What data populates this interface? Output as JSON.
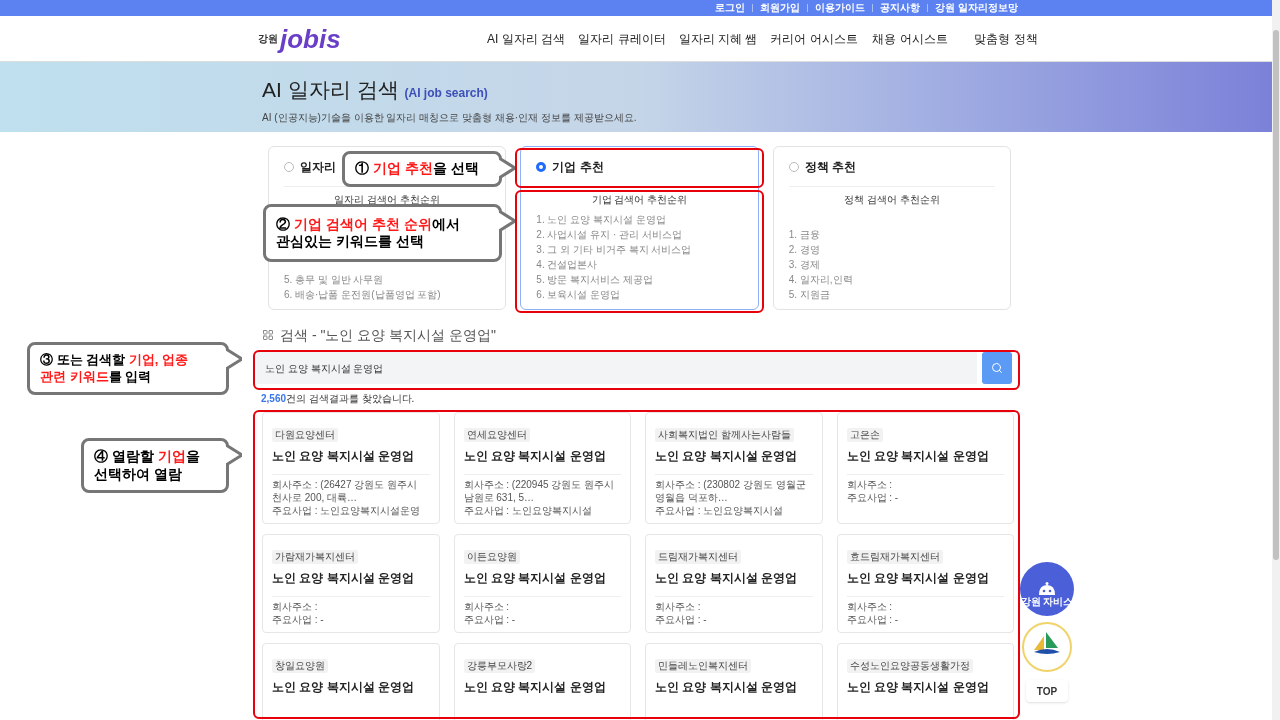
{
  "top_links": [
    "로그인",
    "회원가입",
    "이용가이드",
    "공지사항",
    "강원 일자리정보망"
  ],
  "logo": {
    "region": "강원",
    "name": "jobis"
  },
  "nav": [
    "AI 일자리 검색",
    "일자리 큐레이터",
    "일자리 지혜 쌤",
    "커리어 어시스트",
    "채용 어시스트",
    "맞춤형 정책"
  ],
  "hero": {
    "title": "AI 일자리 검색",
    "title_en": "(AI job search)",
    "description": "AI (인공지능)기술을 이용한 일자리 매칭으로 맞춤형 채용·인재 정보를 제공받으세요."
  },
  "categories": [
    {
      "title": "일자리",
      "selected": false,
      "list_title": "일자리 검색어 추천순위",
      "items": [
        "5. 총무 및 일반 사무원",
        "6. 배송·납품 운전원(납품영업 포함)"
      ]
    },
    {
      "title": "기업 추천",
      "selected": true,
      "list_title": "기업 검색어 추천순위",
      "items": [
        "1. 노인 요양 복지시설 운영업",
        "2. 사업시설 유지 · 관리 서비스업",
        "3. 그 외 기타 비거주 복지 서비스업",
        "4. 건설업본사",
        "5. 방문 복지서비스 제공업",
        "6. 보육시설 운영업"
      ]
    },
    {
      "title": "정책 추천",
      "selected": false,
      "list_title": "정책 검색어 추천순위",
      "items": [
        "1. 금융",
        "2. 경영",
        "3. 경제",
        "4. 일자리,인력",
        "5. 지원금"
      ]
    }
  ],
  "search": {
    "heading": "검색 - \"노인 요양 복지시설 운영업\"",
    "value": "노인 요양 복지시설 운영업"
  },
  "result_count": {
    "number": "2,560",
    "suffix": "건의 검색결과를 찾았습니다."
  },
  "results": [
    {
      "tag": "다원요양센터",
      "title": "노인 요양 복지시설 운영업",
      "address": "회사주소 : (26427 강원도 원주시 천사로 200, 대륙…",
      "business": "주요사업 : 노인요양복지시설운영"
    },
    {
      "tag": "연세요양센터",
      "title": "노인 요양 복지시설 운영업",
      "address": "회사주소 : (220945 강원도 원주시 남원로 631, 5…",
      "business": "주요사업 : 노인요양복지시설"
    },
    {
      "tag": "사회복지법인 함께사는사람들",
      "title": "노인 요양 복지시설 운영업",
      "address": "회사주소 : (230802 강원도 영월군 영월읍 덕포하…",
      "business": "주요사업 : 노인요양복지시설"
    },
    {
      "tag": "고은손",
      "title": "노인 요양 복지시설 운영업",
      "address": "회사주소 :",
      "business": "주요사업 : -"
    },
    {
      "tag": "가람재가복지센터",
      "title": "노인 요양 복지시설 운영업",
      "address": "회사주소 :",
      "business": "주요사업 : -"
    },
    {
      "tag": "이든요양원",
      "title": "노인 요양 복지시설 운영업",
      "address": "회사주소 :",
      "business": "주요사업 : -"
    },
    {
      "tag": "드림재가복지센터",
      "title": "노인 요양 복지시설 운영업",
      "address": "회사주소 :",
      "business": "주요사업 : -"
    },
    {
      "tag": "효드림재가복지센터",
      "title": "노인 요양 복지시설 운영업",
      "address": "회사주소 :",
      "business": "주요사업 : -"
    },
    {
      "tag": "창일요양원",
      "title": "노인 요양 복지시설 운영업"
    },
    {
      "tag": "강릉부모사랑2",
      "title": "노인 요양 복지시설 운영업"
    },
    {
      "tag": "민들레노인복지센터",
      "title": "노인 요양 복지시설 운영업"
    },
    {
      "tag": "수성노인요양공동생활가정",
      "title": "노인 요양 복지시설 운영업"
    }
  ],
  "floating": {
    "assistant": "강원 자비스",
    "top": "TOP"
  },
  "annotations": [
    {
      "lines": [
        [
          {
            "text": "① ",
            "red": false
          },
          {
            "text": "기업 추천",
            "red": true
          },
          {
            "text": "을 선택",
            "red": false
          }
        ]
      ]
    },
    {
      "lines": [
        [
          {
            "text": "② ",
            "red": false
          },
          {
            "text": "기업 검색어 추천 순위",
            "red": true
          },
          {
            "text": "에서",
            "red": false
          }
        ],
        [
          {
            "text": "관심있는 키워드를 선택",
            "red": false
          }
        ]
      ]
    },
    {
      "lines": [
        [
          {
            "text": "③ 또는 검색할 ",
            "red": false
          },
          {
            "text": "기업, 업종",
            "red": true
          }
        ],
        [
          {
            "text": "관련 키워드",
            "red": true
          },
          {
            "text": "를 입력",
            "red": false
          }
        ]
      ]
    },
    {
      "lines": [
        [
          {
            "text": "④ 열람할 ",
            "red": false
          },
          {
            "text": "기업",
            "red": true
          },
          {
            "text": "을",
            "red": false
          }
        ],
        [
          {
            "text": "선택하여 열람",
            "red": false
          }
        ]
      ]
    }
  ]
}
